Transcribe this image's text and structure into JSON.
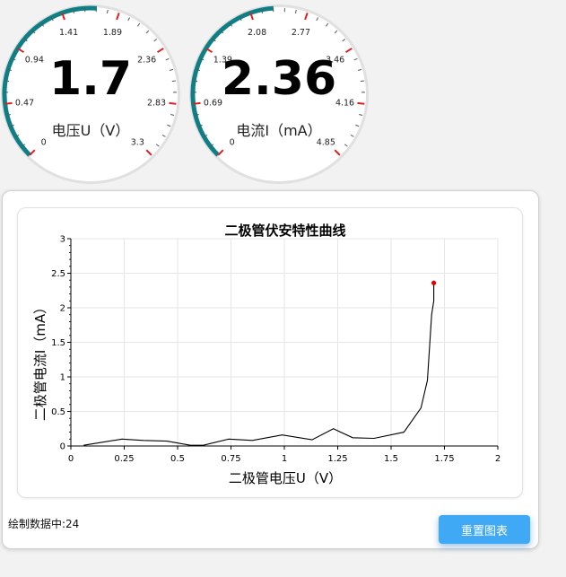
{
  "gauges": [
    {
      "value": "1.7",
      "label": "电压U（V）",
      "min": 0,
      "max": 3.3,
      "current": 1.7,
      "ticks": [
        "0",
        "0.47",
        "0.94",
        "1.41",
        "1.89",
        "2.36",
        "2.83",
        "3.3"
      ]
    },
    {
      "value": "2.36",
      "label": "电流I（mA）",
      "min": 0,
      "max": 4.85,
      "current": 2.36,
      "ticks": [
        "0",
        "0.69",
        "1.39",
        "2.08",
        "2.77",
        "3.46",
        "4.16",
        "4.85"
      ]
    }
  ],
  "colors": {
    "gauge_progress": "#0f7f86",
    "gauge_red_tick": "#e02020",
    "line": "#000000",
    "marker": "#e00000",
    "button": "#3fa9f5"
  },
  "status_text": "绘制数据中:24",
  "reset_button_label": "重置图表",
  "chart_data": {
    "type": "line",
    "title": "二极管伏安特性曲线",
    "xlabel": "二极管电压U（V）",
    "ylabel": "二极管电流I（mA）",
    "xlim": [
      0,
      2
    ],
    "ylim": [
      0,
      3
    ],
    "xticks": [
      "0",
      "0.25",
      "0.5",
      "0.75",
      "1",
      "1.25",
      "1.5",
      "1.75",
      "2"
    ],
    "yticks": [
      "0",
      "0.5",
      "1",
      "1.5",
      "2",
      "2.5",
      "3"
    ],
    "grid": true,
    "series": [
      {
        "x": [
          0.06,
          0.24,
          0.34,
          0.45,
          0.56,
          0.62,
          0.74,
          0.85,
          0.99,
          1.13,
          1.23,
          1.32,
          1.42,
          1.56,
          1.64,
          1.67,
          1.69,
          1.7,
          1.7
        ],
        "y": [
          0.01,
          0.1,
          0.08,
          0.07,
          0.01,
          0.01,
          0.1,
          0.08,
          0.16,
          0.09,
          0.25,
          0.12,
          0.11,
          0.2,
          0.55,
          0.95,
          1.9,
          2.1,
          2.36
        ]
      }
    ],
    "last_point": {
      "x": 1.7,
      "y": 2.36
    }
  }
}
